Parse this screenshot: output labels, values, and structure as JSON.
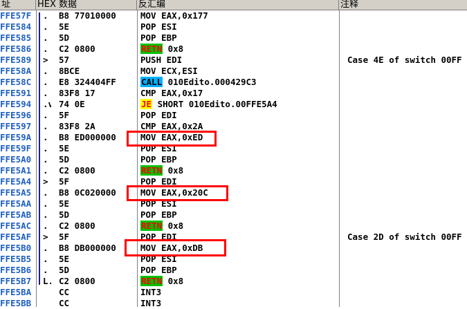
{
  "header": {
    "addr": "址",
    "hex": "HEX 数据",
    "disasm": "反汇编",
    "comment": "注释"
  },
  "rows": [
    {
      "addr": "FFE57F",
      "mark": ".",
      "hex": "B8 77010000",
      "asm": "MOV EAX,0x177",
      "cmt": ""
    },
    {
      "addr": "FFE584",
      "mark": ".",
      "hex": "5E",
      "asm": "POP ESI",
      "cmt": ""
    },
    {
      "addr": "FFE585",
      "mark": ".",
      "hex": "5D",
      "asm": "POP EBP",
      "cmt": ""
    },
    {
      "addr": "FFE586",
      "mark": ".",
      "hex": "C2 0800",
      "asm_mnem": "RETN",
      "asm_rest": " 0x8",
      "mnem_type": "retn",
      "cmt": ""
    },
    {
      "addr": "FFE589",
      "mark": ">",
      "hex": "57",
      "asm": "PUSH EDI",
      "cmt": "Case 4E of switch 00FF"
    },
    {
      "addr": "FFE58A",
      "mark": ".",
      "hex": "8BCE",
      "asm": "MOV ECX,ESI",
      "cmt": ""
    },
    {
      "addr": "FFE58C",
      "mark": ".",
      "hex": "E8 324404FF",
      "asm_mnem": "CALL",
      "asm_rest": " 010Edito.000429C3",
      "mnem_type": "call",
      "cmt": ""
    },
    {
      "addr": "FFE591",
      "mark": ".",
      "hex": "83F8 17",
      "asm": "CMP EAX,0x17",
      "cmt": ""
    },
    {
      "addr": "FFE594",
      "mark": ".v",
      "hex": "74 0E",
      "asm_mnem": "JE",
      "asm_rest": " SHORT 010Edito.00FFE5A4",
      "mnem_type": "je",
      "cmt": ""
    },
    {
      "addr": "FFE596",
      "mark": ".",
      "hex": "5F",
      "asm": "POP EDI",
      "cmt": ""
    },
    {
      "addr": "FFE597",
      "mark": ".",
      "hex": "83F8 2A",
      "asm": "CMP EAX,0x2A",
      "cmt": ""
    },
    {
      "addr": "FFE59A",
      "mark": ".",
      "hex": "B8 ED000000",
      "asm": "MOV EAX,0xED",
      "cmt": ""
    },
    {
      "addr": "FFE59F",
      "mark": ".",
      "hex": "5E",
      "asm": "POP ESI",
      "cmt": ""
    },
    {
      "addr": "FFE5A0",
      "mark": ".",
      "hex": "5D",
      "asm": "POP EBP",
      "cmt": ""
    },
    {
      "addr": "FFE5A1",
      "mark": ".",
      "hex": "C2 0800",
      "asm_mnem": "RETN",
      "asm_rest": " 0x8",
      "mnem_type": "retn",
      "cmt": ""
    },
    {
      "addr": "FFE5A4",
      "mark": ">",
      "hex": "5F",
      "asm": "POP EDI",
      "cmt": ""
    },
    {
      "addr": "FFE5A5",
      "mark": ".",
      "hex": "B8 0C020000",
      "asm": "MOV EAX,0x20C",
      "cmt": ""
    },
    {
      "addr": "FFE5AA",
      "mark": ".",
      "hex": "5E",
      "asm": "POP ESI",
      "cmt": ""
    },
    {
      "addr": "FFE5AB",
      "mark": ".",
      "hex": "5D",
      "asm": "POP EBP",
      "cmt": ""
    },
    {
      "addr": "FFE5AC",
      "mark": ".",
      "hex": "C2 0800",
      "asm_mnem": "RETN",
      "asm_rest": " 0x8",
      "mnem_type": "retn",
      "cmt": ""
    },
    {
      "addr": "FFE5AF",
      "mark": ">",
      "hex": "5F",
      "asm": "POP EDI",
      "cmt": "Case 2D of switch 00FF"
    },
    {
      "addr": "FFE5B0",
      "mark": ".",
      "hex": "B8 DB000000",
      "asm": "MOV EAX,0xDB",
      "cmt": ""
    },
    {
      "addr": "FFE5B5",
      "mark": ".",
      "hex": "5E",
      "asm": "POP ESI",
      "cmt": ""
    },
    {
      "addr": "FFE5B6",
      "mark": ".",
      "hex": "5D",
      "asm": "POP EBP",
      "cmt": ""
    },
    {
      "addr": "FFE5B7",
      "mark": "L.",
      "hex": "C2 0800",
      "asm_mnem": "RETN",
      "asm_rest": " 0x8",
      "mnem_type": "retn",
      "cmt": ""
    },
    {
      "addr": "FFE5BA",
      "mark": "",
      "hex": "CC",
      "asm": "INT3",
      "cmt": ""
    },
    {
      "addr": "FFE5BB",
      "mark": "",
      "hex": "CC",
      "asm": "INT3",
      "cmt": ""
    }
  ],
  "highlight_color": "#ff0000"
}
